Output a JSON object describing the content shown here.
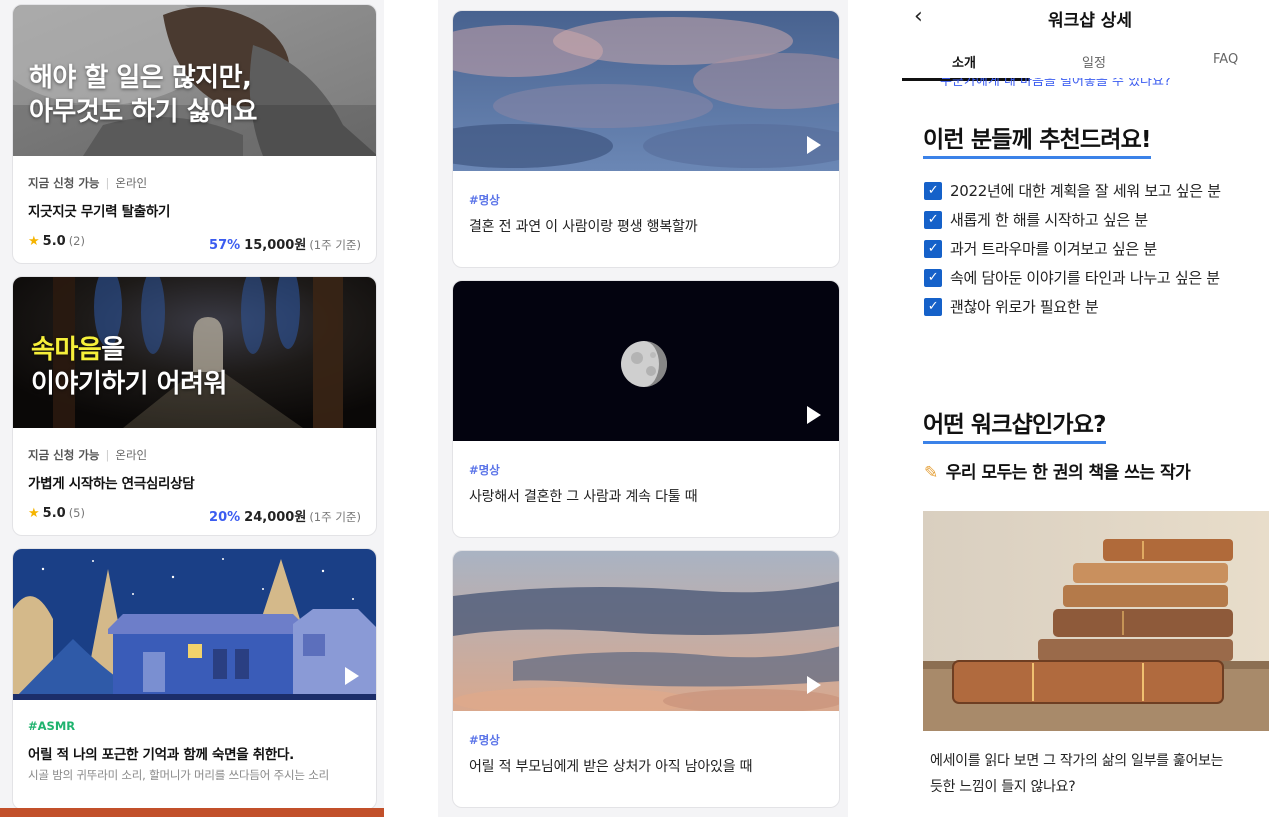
{
  "left_column": {
    "cards": [
      {
        "headline_line1": "해야 할 일은 많지만,",
        "headline_line2": "아무것도 하기 싫어요",
        "availability": "지금 신청 가능",
        "mode": "온라인",
        "title": "지긋지긋 무기력 탈출하기",
        "rating": "5.0",
        "review_count": "(2)",
        "discount": "57%",
        "price": "15,000원",
        "basis": "(1주 기준)"
      },
      {
        "headline_line1_highlight": "속마음",
        "headline_line1_rest": "을",
        "headline_line2": "이야기하기 어려워",
        "availability": "지금 신청 가능",
        "mode": "온라인",
        "title": "가볍게 시작하는 연극심리상담",
        "rating": "5.0",
        "review_count": "(5)",
        "discount": "20%",
        "price": "24,000원",
        "basis": "(1주 기준)"
      },
      {
        "tag": "#ASMR",
        "title": "어릴 적 나의 포근한 기억과 함께 숙면을 취한다.",
        "subtitle": "시골 밤의 귀뚜라미 소리, 할머니가 머리를 쓰다듬어 주시는 소리"
      }
    ]
  },
  "middle_column": {
    "videos": [
      {
        "tag": "#명상",
        "title": "결혼 전 과연 이 사람이랑 평생 행복할까"
      },
      {
        "tag": "#명상",
        "title": "사랑해서 결혼한 그 사람과 계속 다툴 때"
      },
      {
        "tag": "#명상",
        "title": "어릴 적 부모님에게 받은 상처가 아직 남아있을 때"
      }
    ]
  },
  "detail": {
    "page_title": "워크샵 상세",
    "tabs": [
      "소개",
      "일정",
      "FAQ"
    ],
    "active_tab": "소개",
    "clipped_text": "누군가에게 내 마음을 털어놓을 수 있나요?",
    "section1_heading": "이런 분들께 추천드려요!",
    "checklist": [
      "2022년에 대한 계획을 잘 세워 보고 싶은 분",
      "새롭게 한 해를 시작하고 싶은 분",
      "과거 트라우마를 이겨보고 싶은 분",
      "속에 담아둔 이야기를 타인과 나누고 싶은 분",
      "괜찮아 위로가 필요한 분"
    ],
    "section2_heading": "어떤 워크샵인가요?",
    "section2_subheading": "우리 모두는 한 권의 책을 쓰는 작가",
    "paragraph_line1": "에세이를 읽다 보면 그 작가의 삶의 일부를 훑어보는",
    "paragraph_line2": "듯한 느낌이 들지 않나요?"
  },
  "colors": {
    "accent_blue": "#3b5cf0",
    "tag_green": "#1fb36e",
    "tag_blue": "#5b74e8",
    "highlight_yellow": "#f6f03a",
    "heading_underline": "#3b82e8",
    "checkbox": "#1561c9"
  },
  "icons": [
    "star-icon",
    "play-icon",
    "back-arrow-icon",
    "checkbox-checked-icon",
    "pencil-icon"
  ]
}
